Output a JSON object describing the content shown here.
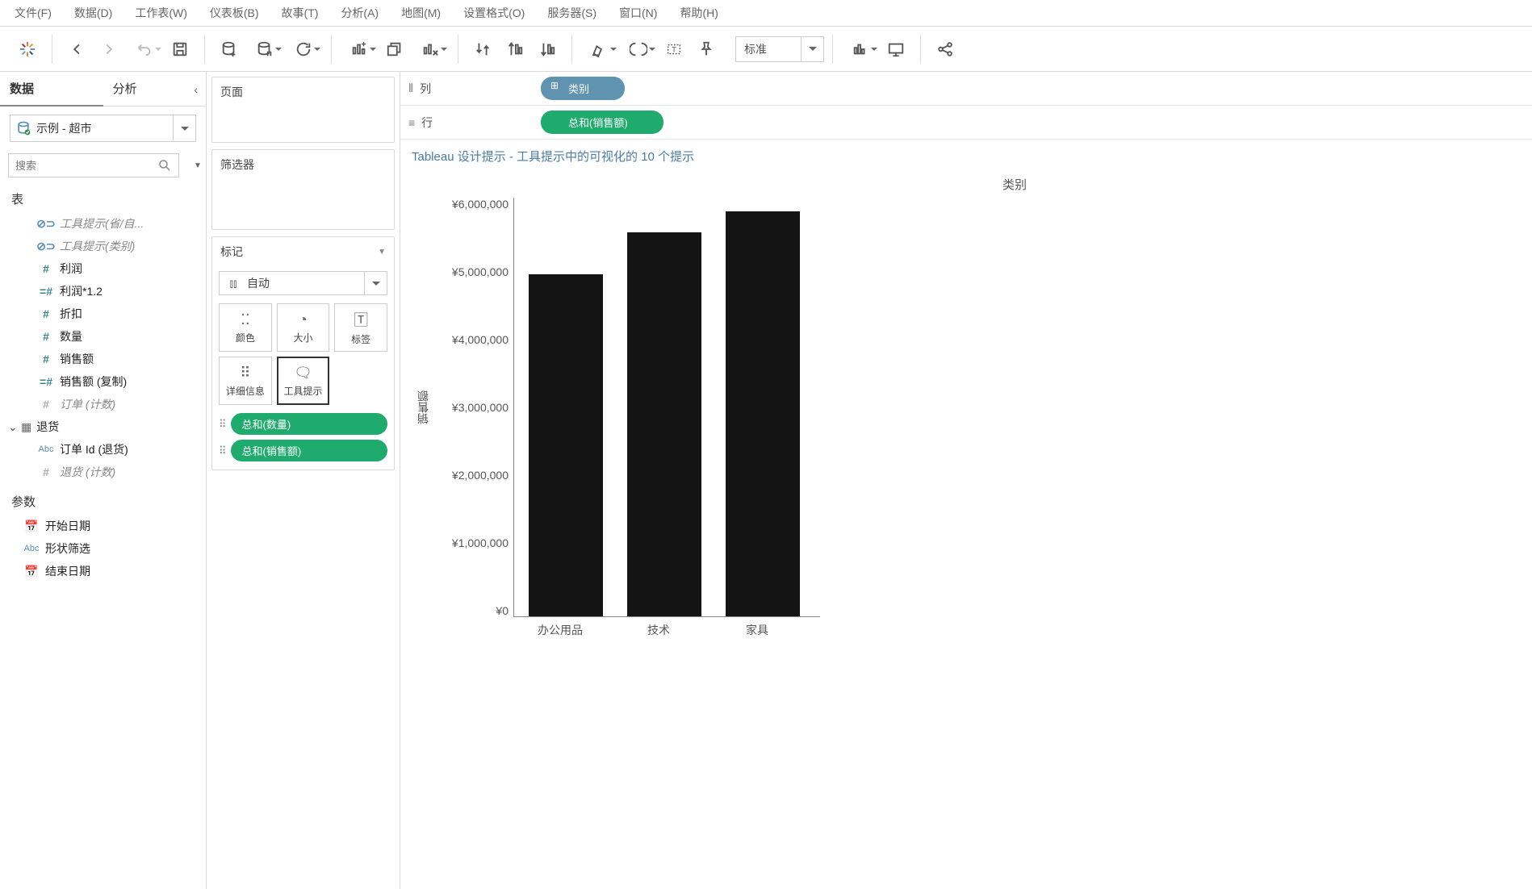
{
  "menu": {
    "file": "文件(F)",
    "data": "数据(D)",
    "worksheet": "工作表(W)",
    "dashboard": "仪表板(B)",
    "story": "故事(T)",
    "analysis": "分析(A)",
    "map": "地图(M)",
    "format": "设置格式(O)",
    "server": "服务器(S)",
    "window": "窗口(N)",
    "help": "帮助(H)"
  },
  "toolbar": {
    "fit": "标准"
  },
  "side": {
    "tab_data": "数据",
    "tab_analysis": "分析",
    "datasource": "示例 - 超市",
    "search_ph": "搜索",
    "sect_tables": "表",
    "fields": {
      "ttip1": "工具提示(省/自...",
      "ttip2": "工具提示(类别)",
      "profit": "利润",
      "profit12": "利润*1.2",
      "discount": "折扣",
      "qty": "数量",
      "sales": "销售额",
      "sales_copy": "销售额 (复制)",
      "orders_cnt": "订单 (计数)"
    },
    "returns_head": "退货",
    "order_id_ret": "订单 Id (退货)",
    "returns_cnt": "退货 (计数)",
    "sect_params": "参数",
    "p_start": "开始日期",
    "p_shape": "形状筛选",
    "p_end": "结束日期"
  },
  "mid": {
    "pages": "页面",
    "filters": "筛选器",
    "marks": "标记",
    "auto": "自动",
    "color": "颜色",
    "size": "大小",
    "label": "标签",
    "detail": "详细信息",
    "tooltip": "工具提示",
    "pill_qty": "总和(数量)",
    "pill_sales": "总和(销售额)"
  },
  "shelf": {
    "cols": "列",
    "rows": "行",
    "pill_dim": "类别",
    "pill_meas": "总和(销售额)"
  },
  "viz": {
    "title": "Tableau 设计提示 - 工具提示中的可视化的 10 个提示",
    "xtitle": "类别",
    "ytitle": "销售额"
  },
  "chart_data": {
    "type": "bar",
    "categories": [
      "办公用品",
      "技术",
      "家具"
    ],
    "values": [
      4900000,
      5500000,
      5800000
    ],
    "title": "类别",
    "xlabel": "类别",
    "ylabel": "销售额",
    "ylim": [
      0,
      6000000
    ],
    "yticks": [
      "¥6,000,000",
      "¥5,000,000",
      "¥4,000,000",
      "¥3,000,000",
      "¥2,000,000",
      "¥1,000,000",
      "¥0"
    ]
  }
}
